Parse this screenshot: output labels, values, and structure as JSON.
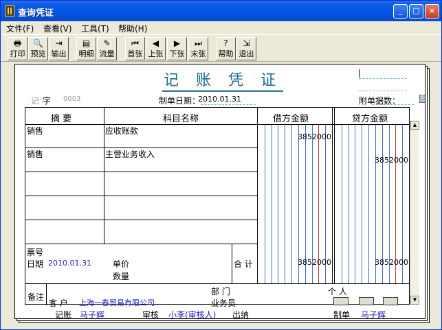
{
  "window": {
    "title": "查询凭证"
  },
  "titlebar_buttons": {
    "minimize": "_",
    "maximize": "□",
    "close": "×"
  },
  "menu": [
    "文件(F)",
    "查看(V)",
    "工具(T)",
    "帮助(H)"
  ],
  "toolbar": [
    {
      "label": "打印",
      "icon": "printer-icon",
      "glyph": "🖶"
    },
    {
      "label": "预览",
      "icon": "preview-icon",
      "glyph": "🔍"
    },
    {
      "label": "输出",
      "icon": "export-icon",
      "glyph": "⇥"
    },
    {
      "label": "明细",
      "icon": "detail-icon",
      "glyph": "▤"
    },
    {
      "label": "流量",
      "icon": "flow-icon",
      "glyph": "✎"
    },
    {
      "label": "首张",
      "icon": "first-icon",
      "glyph": "⏮"
    },
    {
      "label": "上张",
      "icon": "prev-icon",
      "glyph": "◀"
    },
    {
      "label": "下张",
      "icon": "next-icon",
      "glyph": "▶"
    },
    {
      "label": "末张",
      "icon": "last-icon",
      "glyph": "⏭"
    },
    {
      "label": "帮助",
      "icon": "help-icon",
      "glyph": "?"
    },
    {
      "label": "退出",
      "icon": "exit-icon",
      "glyph": "⇲"
    }
  ],
  "voucher": {
    "title": "记 账 凭 证",
    "type_prefix": "记",
    "type_label": "字",
    "number": "0003",
    "date_label": "制单日期：",
    "date": "2010.01.31",
    "attachments_label": "附单据数：",
    "columns": {
      "summary": "摘 要",
      "account": "科目名称",
      "debit": "借方金额",
      "credit": "贷方金额"
    },
    "rows": [
      {
        "summary": "销售",
        "account": "应收账款",
        "debit": "3852000",
        "credit": ""
      },
      {
        "summary": "销售",
        "account": "主营业务收入",
        "debit": "",
        "credit": "3852000"
      },
      {
        "summary": "",
        "account": "",
        "debit": "",
        "credit": ""
      },
      {
        "summary": "",
        "account": "",
        "debit": "",
        "credit": ""
      },
      {
        "summary": "",
        "account": "",
        "debit": "",
        "credit": ""
      }
    ],
    "ticket_label": "票号",
    "date_row_label": "日期",
    "ticket_date": "2010.01.31",
    "unit_price_label": "单价",
    "quantity_label": "数量",
    "total_label": "合 计",
    "total_debit": "3852000",
    "total_credit": "3852000",
    "remark_label": "备注",
    "department_label": "部 门",
    "person_label": "个 人",
    "customer_label": "客 户",
    "customer": "上海一春贸易有限公司",
    "salesman_label": "业务员",
    "bookkeeper_label": "记账",
    "bookkeeper": "马子辉",
    "auditor_label": "审核",
    "auditor": "小李(审核人)",
    "cashier_label": "出纳",
    "cashier": "",
    "maker_label": "制单",
    "maker": "马子辉"
  },
  "colors": {
    "title_blue": "#1a6d8c",
    "value_blue": "#2020c0",
    "money_line_blue": "#4a6cc8",
    "money_line_red": "#d23a3a"
  }
}
